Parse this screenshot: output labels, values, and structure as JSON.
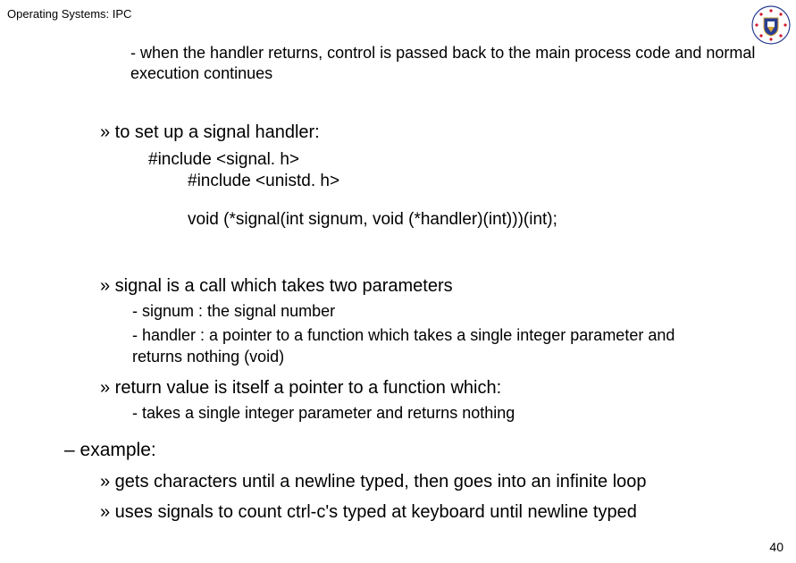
{
  "header": {
    "title": "Operating Systems: IPC"
  },
  "logo": {
    "name": "university-crest-icon",
    "colors": {
      "red": "#d4162e",
      "blue": "#2a3e91",
      "gold": "#d8a73b",
      "white": "#ffffff"
    }
  },
  "slide": {
    "line1": "- when the handler returns, control is passed back to the main process code and normal execution continues",
    "line2": "» to set up a signal handler:",
    "code1": "#include <signal. h>",
    "code2": "#include <unistd. h>",
    "code3": "void (*signal(int signum, void (*handler)(int)))(int);",
    "line3": "» signal is a call which takes two parameters",
    "sub3a": "- signum : the signal number",
    "sub3b": "- handler : a pointer to a function which takes a single integer parameter and",
    "sub3b2": "returns nothing (void)",
    "line4": "» return value is itself a pointer to a function which:",
    "sub4a": "- takes a single integer parameter and returns nothing",
    "line5": "– example:",
    "sub5a": "» gets characters until a newline typed, then goes into an infinite loop",
    "sub5b": "» uses signals to count ctrl-c's typed at keyboard until newline typed"
  },
  "pagenum": "40"
}
